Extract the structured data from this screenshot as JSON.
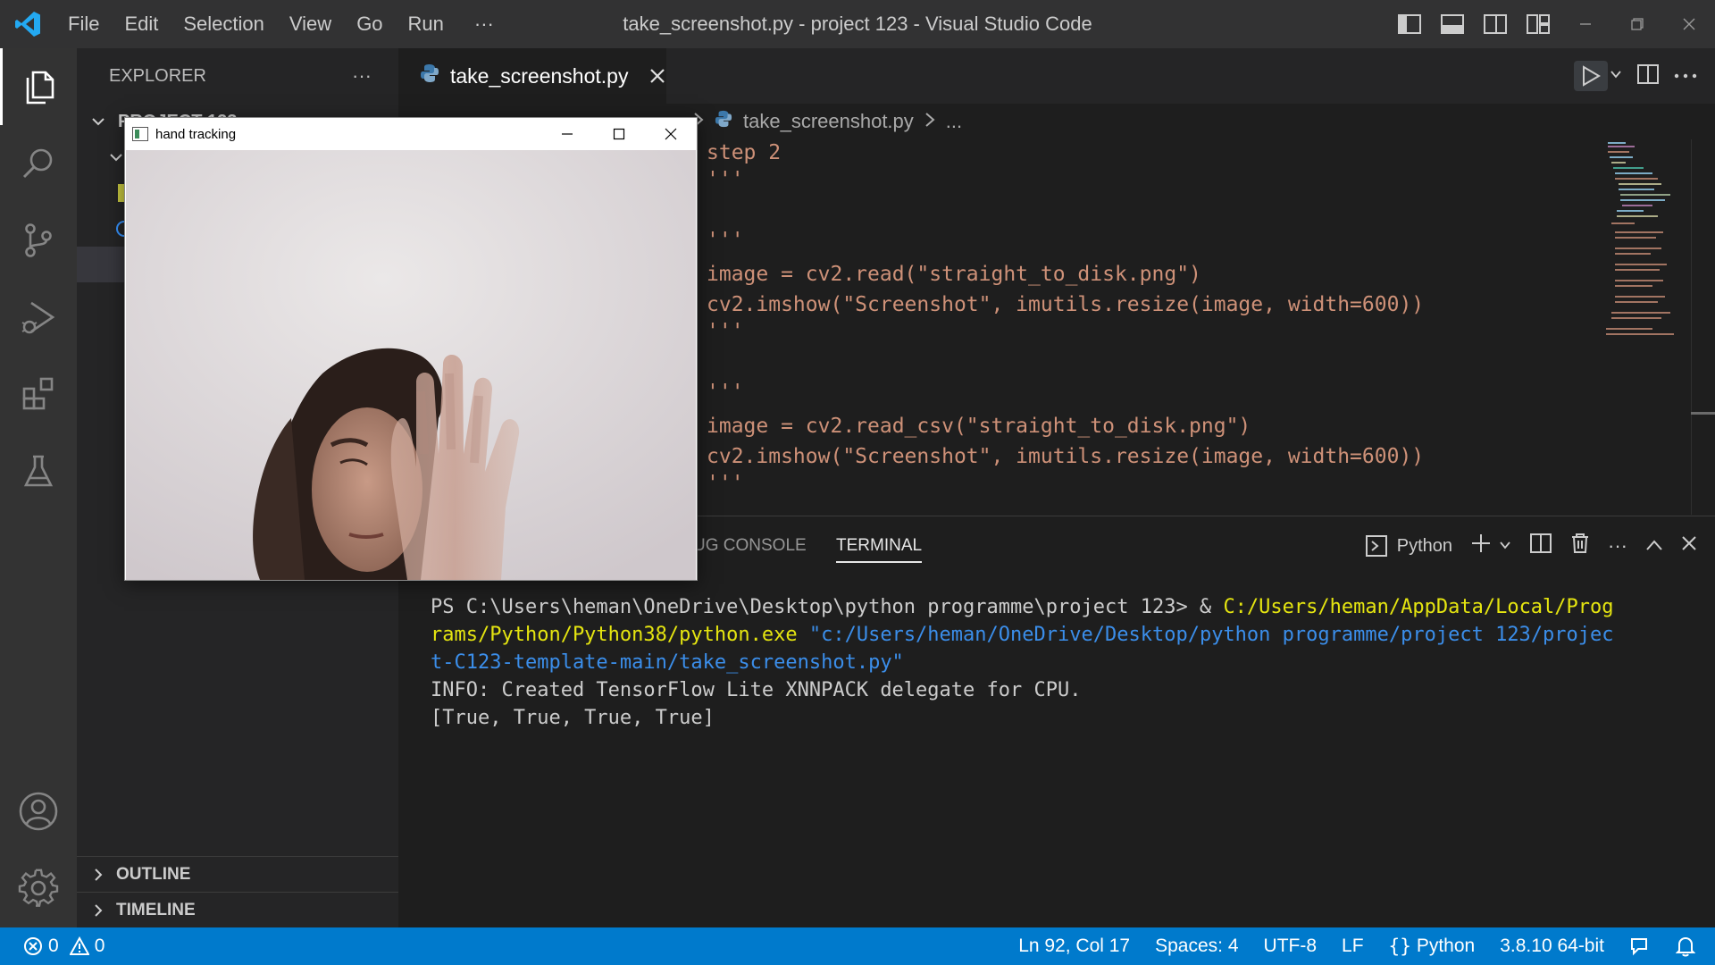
{
  "window": {
    "title": "take_screenshot.py - project 123 - Visual Studio Code",
    "menu": [
      "File",
      "Edit",
      "Selection",
      "View",
      "Go",
      "Run",
      "···"
    ]
  },
  "sidebar": {
    "title": "EXPLORER",
    "more": "···",
    "project_label": "PROJECT 123",
    "sections": [
      "OUTLINE",
      "TIMELINE"
    ]
  },
  "editor": {
    "tab_label": "take_screenshot.py",
    "breadcrumb": {
      "file": "take_screenshot.py",
      "more": "..."
    },
    "code_lines": [
      "step 2",
      "'''",
      "",
      "'''",
      "image = cv2.read(\"straight_to_disk.png\")",
      "cv2.imshow(\"Screenshot\", imutils.resize(image, width=600))",
      "'''",
      "",
      "'''",
      "image = cv2.read_csv(\"straight_to_disk.png\")",
      "cv2.imshow(\"Screenshot\", imutils.resize(image, width=600))",
      "'''"
    ]
  },
  "panel": {
    "tabs": [
      "UG CONSOLE",
      "TERMINAL"
    ],
    "active_tab": "TERMINAL",
    "terminal_profile": "Python",
    "more": "···",
    "terminal": {
      "prompt": "PS C:\\Users\\heman\\OneDrive\\Desktop\\python programme\\project 123> & ",
      "exe_part1": "C:/Users/heman/AppData/Local/Prog",
      "exe_part2": "rams/Python/Python38/python.exe",
      "arg_part1": " \"c:/Users/heman/OneDrive/Desktop/python programme/project 123/projec",
      "arg_part2": "t-C123-template-main/take_screenshot.py\"",
      "info": "INFO: Created TensorFlow Lite XNNPACK delegate for CPU.",
      "output": "[True, True, True, True]"
    }
  },
  "cv_window": {
    "title": "hand tracking"
  },
  "statusbar": {
    "errors": "0",
    "warnings": "0",
    "position": "Ln 92, Col 17",
    "spaces": "Spaces: 4",
    "encoding": "UTF-8",
    "eol": "LF",
    "language": "Python",
    "interpreter": "3.8.10 64-bit"
  },
  "colors": {
    "accent": "#007acc",
    "string": "#ce9178",
    "terminal_yellow": "#e5e510",
    "terminal_blue": "#3b8eea"
  }
}
